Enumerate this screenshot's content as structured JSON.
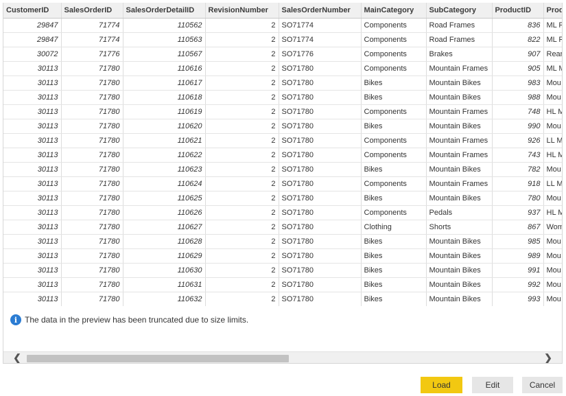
{
  "table": {
    "columns": [
      "CustomerID",
      "SalesOrderID",
      "SalesOrderDetailID",
      "RevisionNumber",
      "SalesOrderNumber",
      "MainCategory",
      "SubCategory",
      "ProductID",
      "Prod"
    ],
    "rows": [
      [
        "29847",
        "71774",
        "110562",
        "2",
        "SO71774",
        "Components",
        "Road Frames",
        "836",
        "ML R"
      ],
      [
        "29847",
        "71774",
        "110563",
        "2",
        "SO71774",
        "Components",
        "Road Frames",
        "822",
        "ML R"
      ],
      [
        "30072",
        "71776",
        "110567",
        "2",
        "SO71776",
        "Components",
        "Brakes",
        "907",
        "Rear"
      ],
      [
        "30113",
        "71780",
        "110616",
        "2",
        "SO71780",
        "Components",
        "Mountain Frames",
        "905",
        "ML M"
      ],
      [
        "30113",
        "71780",
        "110617",
        "2",
        "SO71780",
        "Bikes",
        "Mountain Bikes",
        "983",
        "Mou"
      ],
      [
        "30113",
        "71780",
        "110618",
        "2",
        "SO71780",
        "Bikes",
        "Mountain Bikes",
        "988",
        "Mou"
      ],
      [
        "30113",
        "71780",
        "110619",
        "2",
        "SO71780",
        "Components",
        "Mountain Frames",
        "748",
        "HL M"
      ],
      [
        "30113",
        "71780",
        "110620",
        "2",
        "SO71780",
        "Bikes",
        "Mountain Bikes",
        "990",
        "Mou"
      ],
      [
        "30113",
        "71780",
        "110621",
        "2",
        "SO71780",
        "Components",
        "Mountain Frames",
        "926",
        "LL M"
      ],
      [
        "30113",
        "71780",
        "110622",
        "2",
        "SO71780",
        "Components",
        "Mountain Frames",
        "743",
        "HL M"
      ],
      [
        "30113",
        "71780",
        "110623",
        "2",
        "SO71780",
        "Bikes",
        "Mountain Bikes",
        "782",
        "Mou"
      ],
      [
        "30113",
        "71780",
        "110624",
        "2",
        "SO71780",
        "Components",
        "Mountain Frames",
        "918",
        "LL M"
      ],
      [
        "30113",
        "71780",
        "110625",
        "2",
        "SO71780",
        "Bikes",
        "Mountain Bikes",
        "780",
        "Mou"
      ],
      [
        "30113",
        "71780",
        "110626",
        "2",
        "SO71780",
        "Components",
        "Pedals",
        "937",
        "HL M"
      ],
      [
        "30113",
        "71780",
        "110627",
        "2",
        "SO71780",
        "Clothing",
        "Shorts",
        "867",
        "Wom"
      ],
      [
        "30113",
        "71780",
        "110628",
        "2",
        "SO71780",
        "Bikes",
        "Mountain Bikes",
        "985",
        "Mou"
      ],
      [
        "30113",
        "71780",
        "110629",
        "2",
        "SO71780",
        "Bikes",
        "Mountain Bikes",
        "989",
        "Mou"
      ],
      [
        "30113",
        "71780",
        "110630",
        "2",
        "SO71780",
        "Bikes",
        "Mountain Bikes",
        "991",
        "Mou"
      ],
      [
        "30113",
        "71780",
        "110631",
        "2",
        "SO71780",
        "Bikes",
        "Mountain Bikes",
        "992",
        "Mou"
      ],
      [
        "30113",
        "71780",
        "110632",
        "2",
        "SO71780",
        "Bikes",
        "Mountain Bikes",
        "993",
        "Mou"
      ]
    ]
  },
  "notice": {
    "icon": "info-icon",
    "text": "The data in the preview has been truncated due to size limits."
  },
  "scrollbar": {
    "left_icon": "chevron-left-icon",
    "right_icon": "chevron-right-icon",
    "position": 0
  },
  "buttons": {
    "load": "Load",
    "edit": "Edit",
    "cancel": "Cancel"
  },
  "colors": {
    "accent": "#f2c811",
    "info": "#2b7cd3"
  }
}
